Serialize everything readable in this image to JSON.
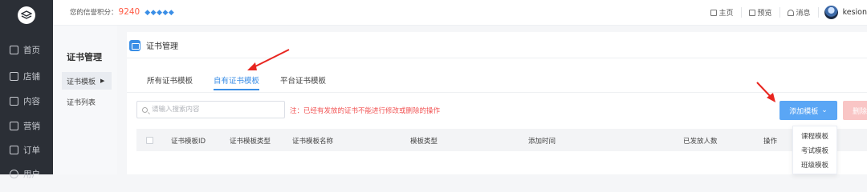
{
  "sidebar": {
    "items": [
      {
        "label": "首页",
        "icon": "home-icon"
      },
      {
        "label": "店铺",
        "icon": "store-icon"
      },
      {
        "label": "内容",
        "icon": "content-icon"
      },
      {
        "label": "营销",
        "icon": "marketing-icon"
      },
      {
        "label": "订单",
        "icon": "order-icon"
      },
      {
        "label": "用户",
        "icon": "user-icon"
      }
    ]
  },
  "header": {
    "credit_label": "您的信誉积分：",
    "credit_value": "9240",
    "gems": "💎💎💎💎💎",
    "links": [
      {
        "label": "主页",
        "icon": "home-icon"
      },
      {
        "label": "预览",
        "icon": "monitor-icon"
      },
      {
        "label": "消息",
        "icon": "bell-icon"
      }
    ],
    "username": "kesion"
  },
  "subnav": {
    "title": "证书管理",
    "items": [
      {
        "label": "证书模板",
        "active": true
      },
      {
        "label": "证书列表",
        "active": false
      }
    ]
  },
  "page": {
    "title": "证书管理",
    "tabs": [
      {
        "label": "所有证书模板",
        "active": false
      },
      {
        "label": "自有证书模板",
        "active": true
      },
      {
        "label": "平台证书模板",
        "active": false
      }
    ],
    "search_placeholder": "请输入搜索内容",
    "note": "注：已经有发放的证书不能进行修改或删除的操作",
    "add_button": "添加模板",
    "delete_button": "删除",
    "columns": [
      "证书模板ID",
      "证书模板类型",
      "证书模板名称",
      "模板类型",
      "添加时间",
      "已发放人数",
      "操作"
    ],
    "dropdown": [
      "课程模板",
      "考试模板",
      "班级模板"
    ]
  },
  "colors": {
    "accent": "#3a8ee6",
    "warning": "#f25555",
    "sidebar_bg": "#2b2f36"
  }
}
